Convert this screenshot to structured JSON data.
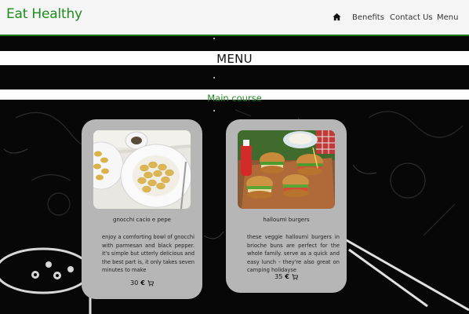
{
  "navbar": {
    "brand": "Eat Healthy",
    "links": [
      "Benefits",
      "Contact Us",
      "Menu"
    ],
    "home_icon": "home-icon"
  },
  "menu": {
    "title": "MENU",
    "section": "Main course"
  },
  "cards": [
    {
      "name": "gnocchi cacio e pepe",
      "description": "enjoy a comforting bowl of gnocchi with parmesan and black pepper. it's simple but utterly delicious and the best part is, it only takes seven minutes to make",
      "price": "30",
      "currency": "€",
      "cart_icon": "cart-icon"
    },
    {
      "name": "halloumi burgers",
      "description": "these veggie halloumi burgers in brioche buns are perfect for the whole family. serve as a quick and easy lunch - they're also great on camping holidayse",
      "price": "35",
      "currency": "€",
      "cart_icon": "cart-icon"
    }
  ],
  "colors": {
    "brand_green": "#1e8b1e",
    "background": "#050505",
    "card": "#b6b6b6"
  }
}
